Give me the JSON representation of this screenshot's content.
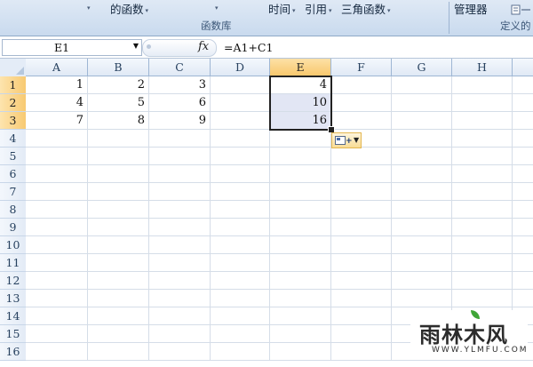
{
  "ribbon": {
    "row1": [
      "的函数",
      "时间",
      "引用",
      "三角函数",
      "管理器"
    ],
    "group_formula_library": "函数库",
    "group_defined_names": "定义的"
  },
  "formula_bar": {
    "name_box": "E1",
    "fx_label": "fx",
    "formula": "=A1+C1"
  },
  "columns": [
    "A",
    "B",
    "C",
    "D",
    "E",
    "F",
    "G",
    "H"
  ],
  "rows": [
    "1",
    "2",
    "3",
    "4",
    "5",
    "6",
    "7",
    "8",
    "9",
    "10",
    "11",
    "12",
    "13",
    "14",
    "15",
    "16"
  ],
  "cells": {
    "A1": "1",
    "B1": "2",
    "C1": "3",
    "E1": "4",
    "A2": "4",
    "B2": "5",
    "C2": "6",
    "E2": "10",
    "A3": "7",
    "B3": "8",
    "C3": "9",
    "E3": "16"
  },
  "selection": {
    "range": "E1:E3",
    "active_cell": "E1"
  },
  "watermark": {
    "text": "雨林木风",
    "url": "WWW.YLMFU.COM"
  },
  "colors": {
    "selected_header": "#f8c86d",
    "selection_fill": "#e2e6f4",
    "ribbon": "#c9daee"
  }
}
